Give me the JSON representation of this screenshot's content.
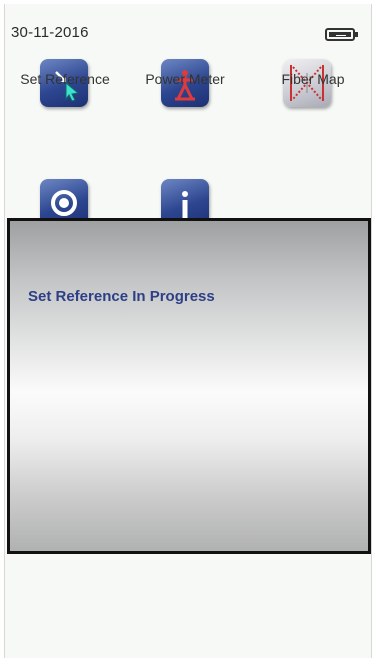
{
  "status_bar": {
    "date": "30-11-2016",
    "battery_icon": "battery-plug-icon"
  },
  "apps": [
    {
      "label": "Set Reference",
      "icon": "set-reference-icon"
    },
    {
      "label": "Power Meter",
      "icon": "power-meter-icon"
    },
    {
      "label": "Fiber Map",
      "icon": "fiber-map-icon"
    },
    {
      "label": "",
      "icon": "settings-gear-icon"
    },
    {
      "label": "",
      "icon": "info-icon"
    }
  ],
  "dialog": {
    "message": "Set Reference In Progress"
  },
  "colors": {
    "icon_blue": "#2d4690",
    "message_text": "#2d3f86",
    "dialog_border": "#111111"
  }
}
